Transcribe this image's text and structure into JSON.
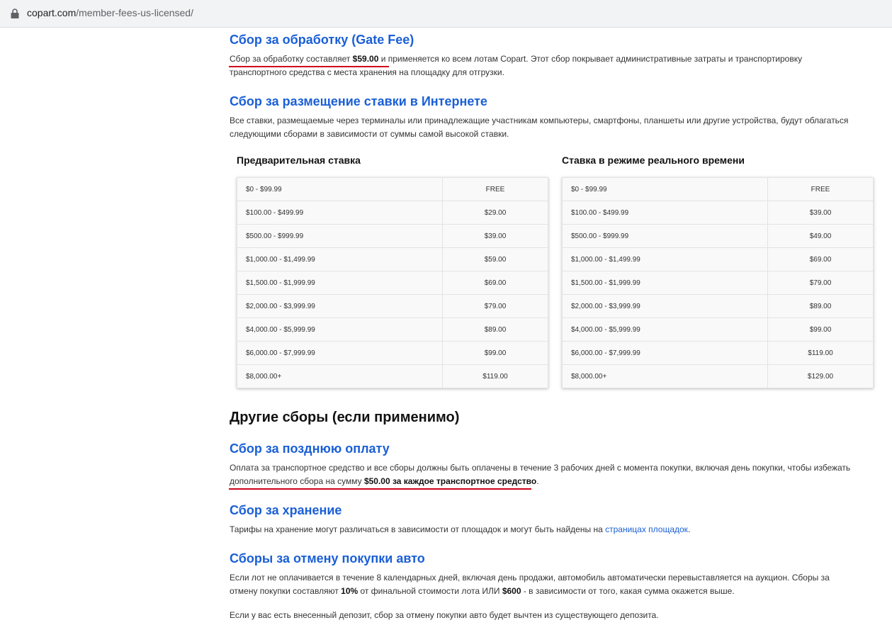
{
  "browser": {
    "url_domain": "copart.com",
    "url_path": "/member-fees-us-licensed/"
  },
  "gate_fee": {
    "title": "Сбор за обработку (Gate Fee)",
    "text_pre": "Сбор за обработку составляет ",
    "amount": "$59.00",
    "text_post": " и применяется ко всем лотам Copart. Этот сбор покрывает административные затраты и транспортировку транспортного средства с места хранения на площадку для отгрузки."
  },
  "internet_bid_fee": {
    "title": "Сбор за размещение ставки в Интернете",
    "text": "Все ставки, размещаемые через терминалы или принадлежащие участникам компьютеры, смартфоны, планшеты или другие устройства, будут облагаться следующими сборами в зависимости от суммы самой высокой ставки."
  },
  "preliminary_table": {
    "title": "Предварительная ставка",
    "rows": [
      [
        "$0 - $99.99",
        "FREE"
      ],
      [
        "$100.00 - $499.99",
        "$29.00"
      ],
      [
        "$500.00 - $999.99",
        "$39.00"
      ],
      [
        "$1,000.00 - $1,499.99",
        "$59.00"
      ],
      [
        "$1,500.00 - $1,999.99",
        "$69.00"
      ],
      [
        "$2,000.00 - $3,999.99",
        "$79.00"
      ],
      [
        "$4,000.00 - $5,999.99",
        "$89.00"
      ],
      [
        "$6,000.00 - $7,999.99",
        "$99.00"
      ],
      [
        "$8,000.00+",
        "$119.00"
      ]
    ]
  },
  "realtime_table": {
    "title": "Ставка в режиме реального времени",
    "rows": [
      [
        "$0 - $99.99",
        "FREE"
      ],
      [
        "$100.00 - $499.99",
        "$39.00"
      ],
      [
        "$500.00 - $999.99",
        "$49.00"
      ],
      [
        "$1,000.00 - $1,499.99",
        "$69.00"
      ],
      [
        "$1,500.00 - $1,999.99",
        "$79.00"
      ],
      [
        "$2,000.00 - $3,999.99",
        "$89.00"
      ],
      [
        "$4,000.00 - $5,999.99",
        "$99.00"
      ],
      [
        "$6,000.00 - $7,999.99",
        "$119.00"
      ],
      [
        "$8,000.00+",
        "$129.00"
      ]
    ]
  },
  "other_fees": {
    "title": "Другие сборы (если применимо)"
  },
  "late_payment": {
    "title": "Сбор за позднюю оплату",
    "text_pre": "Оплата за транспортное средство и все сборы должны быть оплачены в течение 3 рабочих дней с момента покупки, включая день покупки, чтобы избежать дополнительного сбора на сумму ",
    "amount_bold": "$50.00 за каждое транспортное средство",
    "text_post": "."
  },
  "storage": {
    "title": "Сбор за хранение",
    "text_pre": "Тарифы на хранение могут различаться в зависимости от площадок и могут быть найдены на ",
    "link": "страницах площадок",
    "text_post": "."
  },
  "cancellation": {
    "title": "Сборы за отмену покупки авто",
    "text_1": "Если лот не оплачивается в течение 8 календарных дней, включая день продажи, автомобиль автоматически перевыставляется на аукцион. Сборы за отмену покупки составляют ",
    "percent": "10%",
    "text_2": " от финальной стоимости лота ИЛИ ",
    "fixed": "$600",
    "text_3": " - в зависимости от того, какая сумма окажется выше.",
    "deposit_text": "Если у вас есть внесенный депозит, сбор за отмену покупки авто будет вычтен из существующего депозита."
  },
  "colors": {
    "heading_blue": "#1a5fd6",
    "underline_red": "#d0021b",
    "table_bg": "#f9f9f9"
  },
  "icons": {
    "address_bar": "lock-icon"
  }
}
